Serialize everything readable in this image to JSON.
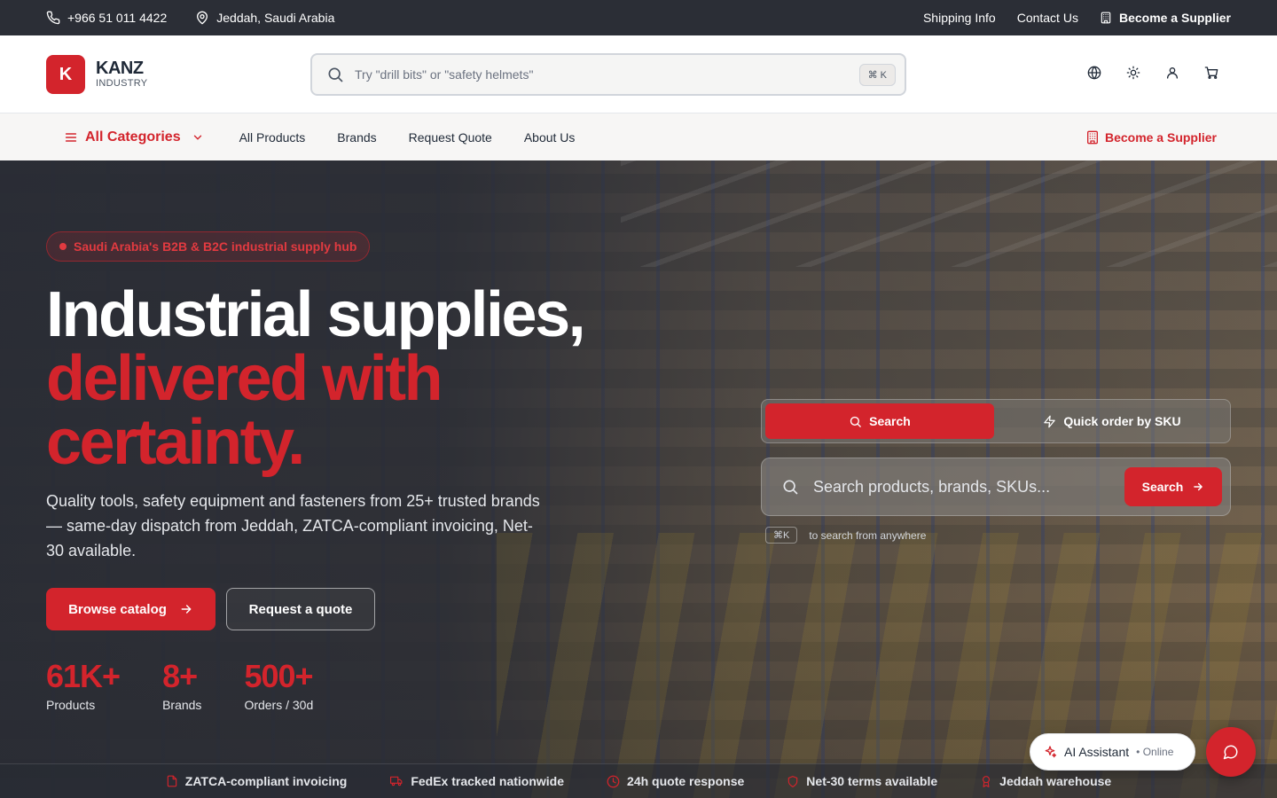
{
  "topbar": {
    "phone": "+966 51 011 4422",
    "location": "Jeddah, Saudi Arabia",
    "shipping": "Shipping Info",
    "contact": "Contact Us",
    "supplier": "Become a Supplier"
  },
  "header": {
    "logo_letter": "K",
    "brand": "KANZ",
    "brand_sub": "INDUSTRY",
    "search_placeholder": "Try \"drill bits\" or \"safety helmets\"",
    "shortcut": "⌘ K",
    "icons": [
      "globe-icon",
      "sun-icon",
      "user-icon",
      "cart-icon"
    ]
  },
  "nav": {
    "categories": "All Categories",
    "links": [
      "All Products",
      "Brands",
      "Request Quote",
      "About Us"
    ],
    "supplier": "Become a Supplier"
  },
  "hero": {
    "badge": "Saudi Arabia's B2B & B2C industrial supply hub",
    "title_line1": "Industrial supplies,",
    "title_line2": "delivered with",
    "title_line3": "certainty.",
    "subtitle": "Quality tools, safety equipment and fasteners from 25+ trusted brands — same-day dispatch from Jeddah, ZATCA-compliant invoicing, Net-30 available.",
    "cta_primary": "Browse catalog",
    "cta_secondary": "Request a quote",
    "stats": [
      {
        "value": "61K+",
        "label": "Products"
      },
      {
        "value": "8+",
        "label": "Brands"
      },
      {
        "value": "500+",
        "label": "Orders / 30d"
      }
    ],
    "tabs": {
      "search": "Search",
      "sku": "Quick order by SKU"
    },
    "search_placeholder": "Search products, brands, SKUs...",
    "search_button": "Search",
    "hint_key": "⌘K",
    "hint_text": "to search from anywhere"
  },
  "features": [
    "ZATCA-compliant invoicing",
    "FedEx tracked nationwide",
    "24h quote response",
    "Net-30 terms available",
    "Jeddah warehouse"
  ],
  "assistant": {
    "label": "AI Assistant",
    "status": "• Online"
  },
  "colors": {
    "accent": "#d3242c",
    "dark": "#2b2e36"
  }
}
